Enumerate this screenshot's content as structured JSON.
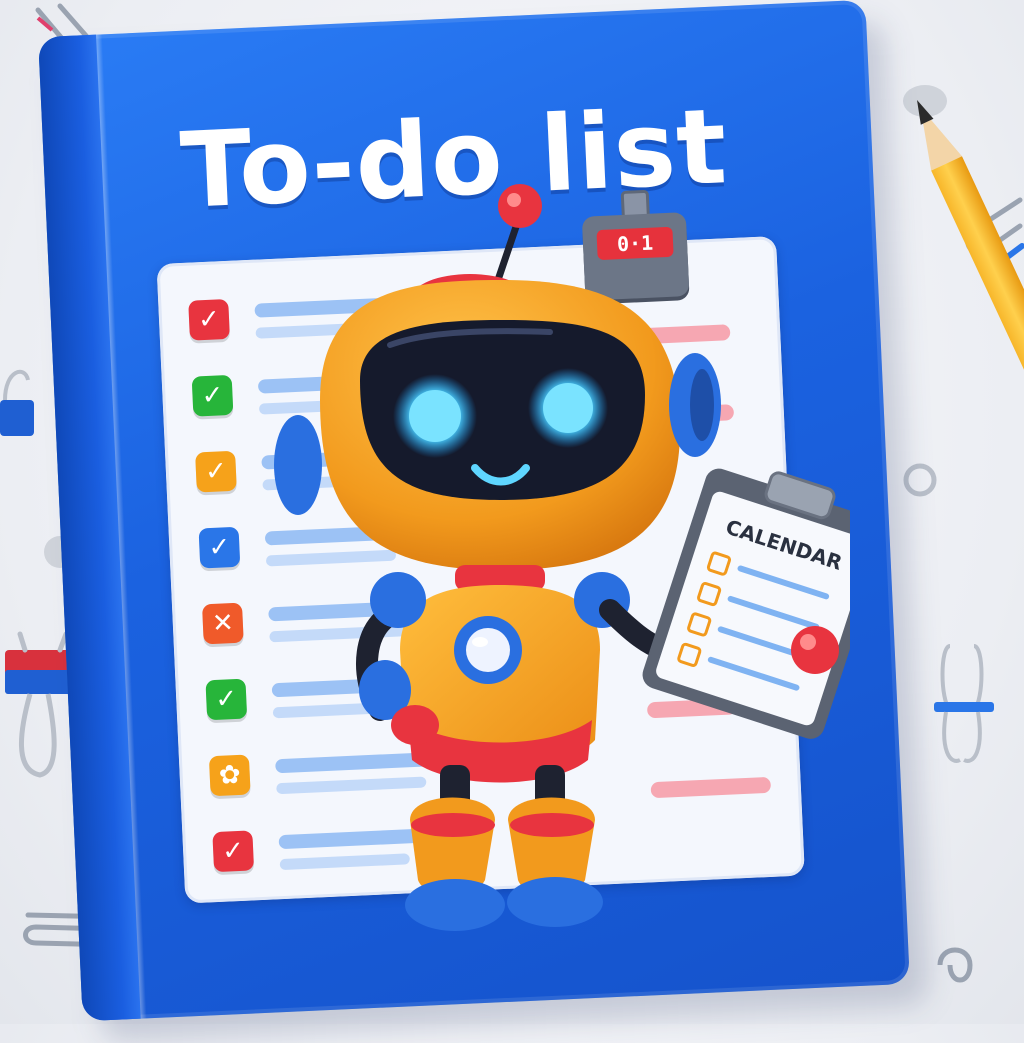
{
  "cover": {
    "title": "To-do list"
  },
  "badge": {
    "counter": "0·1"
  },
  "clipboard": {
    "title": "CALENDAR"
  },
  "checklist": [
    {
      "status": "checked",
      "color": "#e8343f",
      "mark": "✓"
    },
    {
      "status": "checked",
      "color": "#27b53a",
      "mark": "✓"
    },
    {
      "status": "checked",
      "color": "#f6a21a",
      "mark": "✓"
    },
    {
      "status": "checked",
      "color": "#2a76e8",
      "mark": "✓"
    },
    {
      "status": "rejected",
      "color": "#f05a2a",
      "mark": "✕"
    },
    {
      "status": "checked",
      "color": "#27b53a",
      "mark": "✓"
    },
    {
      "status": "pending",
      "color": "#f6a21a",
      "mark": "✿"
    },
    {
      "status": "checked",
      "color": "#e8343f",
      "mark": "✓"
    }
  ],
  "colors": {
    "cover_blue": "#1b62e0",
    "robot_orange": "#f3a524",
    "robot_red": "#e8343f",
    "robot_blue": "#2a6fe0",
    "visor": "#151a2c",
    "eye_glow": "#4fd2ff",
    "pencil_yellow": "#ffc93a",
    "background": "#eceef3"
  },
  "icons": {
    "robot": "robot-mascot-icon",
    "pencil": "pencil-icon",
    "paperclip": "paperclip-icon",
    "binder_clip": "binder-clip-icon",
    "badge": "counter-badge-icon"
  }
}
